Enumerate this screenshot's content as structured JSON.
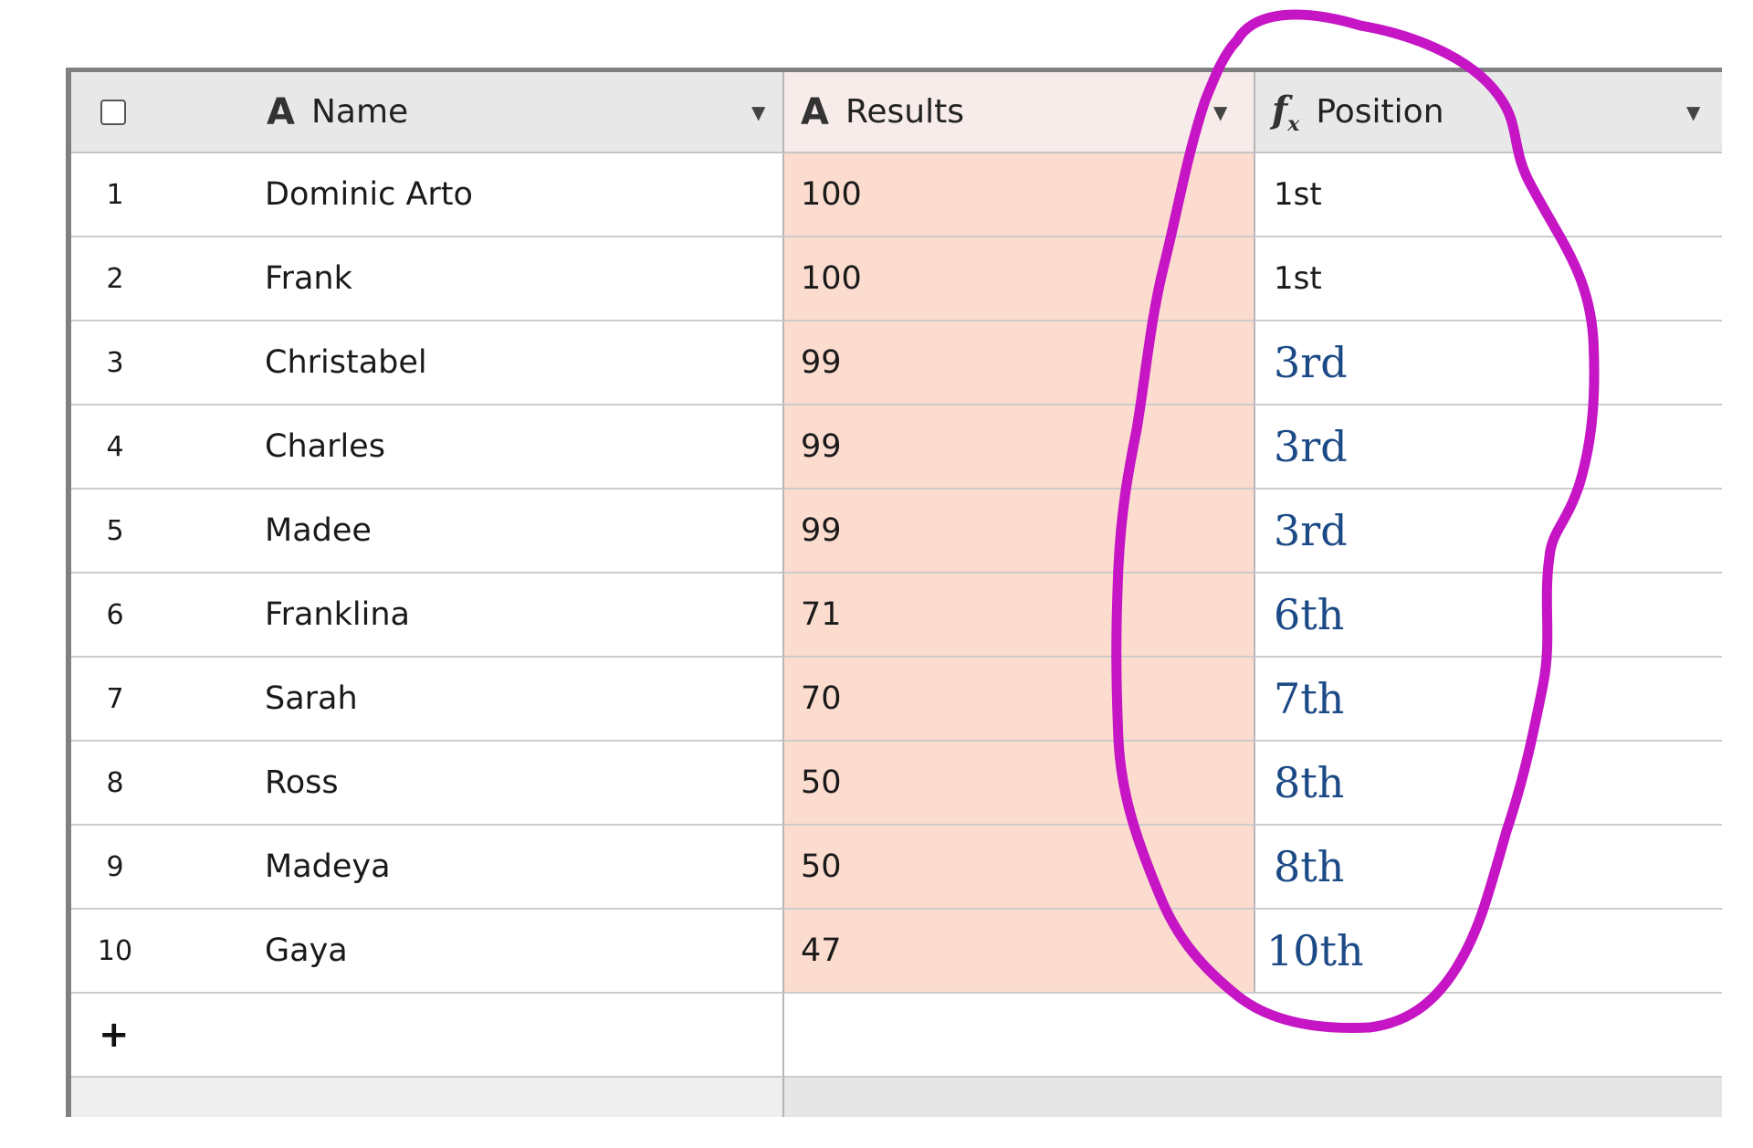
{
  "columns": [
    {
      "label": "Name",
      "icon": "text-type-icon"
    },
    {
      "label": "Results",
      "icon": "text-type-icon"
    },
    {
      "label": "Position",
      "icon": "formula-fx-icon"
    }
  ],
  "type_icon_glyph": "A",
  "formula_icon_glyph": "f",
  "formula_icon_sub": "x",
  "dropdown_glyph": "▼",
  "add_glyph": "+",
  "rows": [
    {
      "num": "1",
      "name": "Dominic Arto",
      "results": "100",
      "position": "1st"
    },
    {
      "num": "2",
      "name": "Frank",
      "results": "100",
      "position": "1st"
    },
    {
      "num": "3",
      "name": "Christabel",
      "results": "99",
      "position": "3rd"
    },
    {
      "num": "4",
      "name": "Charles",
      "results": "99",
      "position": "3rd"
    },
    {
      "num": "5",
      "name": "Madee",
      "results": "99",
      "position": "3rd"
    },
    {
      "num": "6",
      "name": "Franklina",
      "results": "71",
      "position": "6th"
    },
    {
      "num": "7",
      "name": "Sarah",
      "results": "70",
      "position": "7th"
    },
    {
      "num": "8",
      "name": "Ross",
      "results": "50",
      "position": "8th"
    },
    {
      "num": "9",
      "name": "Madeya",
      "results": "50",
      "position": "8th"
    },
    {
      "num": "10",
      "name": "Gaya",
      "results": "47",
      "position": "10th"
    }
  ],
  "colors": {
    "results_fill": "#fbdccf",
    "annotation_stroke": "#c515c5",
    "handwritten_text": "#1c4a86"
  }
}
